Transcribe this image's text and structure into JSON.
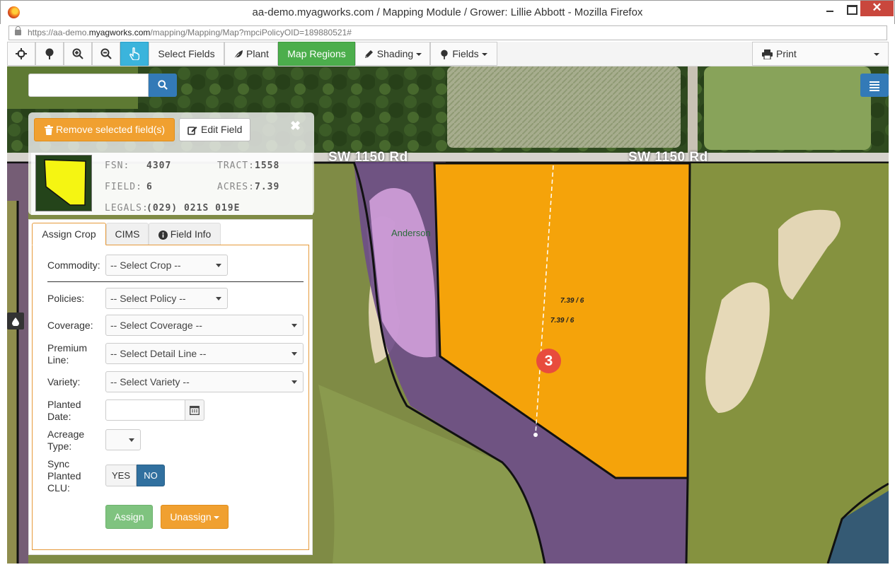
{
  "window": {
    "title": "aa-demo.myagworks.com / Mapping Module / Grower: Lillie Abbott - Mozilla Firefox",
    "close_glyph": "✕"
  },
  "url": {
    "prefix": "https://aa-demo.",
    "domain": "myagworks.com",
    "path": "/mapping/Mapping/Map?mpciPolicyOID=189880521#"
  },
  "toolbar": {
    "select_fields": "Select Fields",
    "plant": "Plant",
    "map_regions": "Map Regions",
    "shading": "Shading",
    "fields": "Fields",
    "print": "Print"
  },
  "map": {
    "road_labels": [
      "SW 1150 Rd",
      "SW 1150 Rd"
    ],
    "poi_label": "Anderson",
    "field_labels": [
      "7.39 / 6",
      "7.39 / 6"
    ],
    "marker_number": "3"
  },
  "panel": {
    "remove_label": "Remove selected field(s)",
    "edit_label": "Edit Field",
    "close_glyph": "✖",
    "info": {
      "fsn_label": "FSN:",
      "fsn_value": "4307",
      "tract_label": "TRACT:",
      "tract_value": "1558",
      "field_label": "FIELD:",
      "field_value": "6",
      "acres_label": "ACRES:",
      "acres_value": "7.39",
      "legals_label": "LEGALS:",
      "legals_value": "(029) 021S 019E"
    },
    "tabs": [
      "Assign Crop",
      "CIMS",
      "Field Info"
    ],
    "form": {
      "commodity_label": "Commodity:",
      "commodity_value": "-- Select Crop --",
      "policies_label": "Policies:",
      "policies_value": "-- Select Policy --",
      "coverage_label": "Coverage:",
      "coverage_value": "-- Select Coverage --",
      "premium_label_1": "Premium",
      "premium_label_2": "Line:",
      "premium_value": "-- Select Detail Line --",
      "variety_label": "Variety:",
      "variety_value": "-- Select Variety --",
      "planted_label_1": "Planted",
      "planted_label_2": "Date:",
      "planted_value": "",
      "acreage_label_1": "Acreage",
      "acreage_label_2": "Type:",
      "acreage_value": "",
      "sync_label_1": "Sync",
      "sync_label_2": "Planted",
      "sync_label_3": "CLU:",
      "yes_label": "YES",
      "no_label": "NO",
      "assign_label": "Assign",
      "unassign_label": "Unassign"
    }
  }
}
